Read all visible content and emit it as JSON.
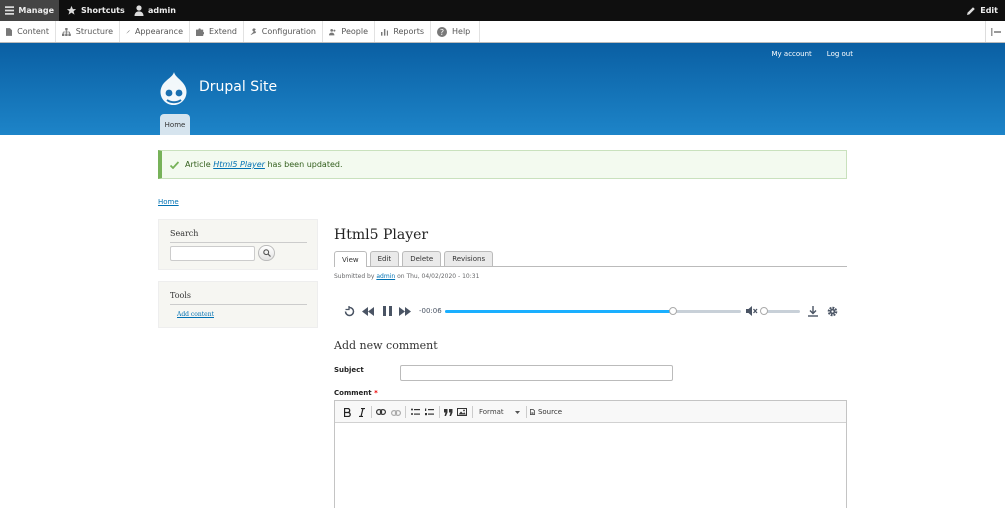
{
  "toolbar": {
    "manage": "Manage",
    "shortcuts": "Shortcuts",
    "user": "admin",
    "edit": "Edit"
  },
  "tray": {
    "items": [
      "Content",
      "Structure",
      "Appearance",
      "Extend",
      "Configuration",
      "People",
      "Reports",
      "Help"
    ]
  },
  "header": {
    "site_name": "Drupal Site",
    "account_links": [
      "My account",
      "Log out"
    ],
    "main_tab": "Home"
  },
  "message": {
    "prefix": "Article",
    "link": "Html5 Player",
    "suffix": "has been updated."
  },
  "breadcrumb": "Home",
  "sidebar": {
    "search_title": "Search",
    "tools_title": "Tools",
    "tools_link": "Add content"
  },
  "node": {
    "title": "Html5 Player",
    "tabs": [
      "View",
      "Edit",
      "Delete",
      "Revisions"
    ],
    "submitted_prefix": "Submitted by",
    "author": "admin",
    "submitted_date": "on Thu, 04/02/2020 - 10:31"
  },
  "player": {
    "time": "-00:06",
    "progress": 0.77,
    "volume": 0.0,
    "muted": true,
    "accent_color": "#1aafff"
  },
  "comment": {
    "heading": "Add new comment",
    "subject_label": "Subject",
    "comment_label": "Comment",
    "required_marker": "*",
    "format_label": "Format",
    "source_label": "Source"
  }
}
